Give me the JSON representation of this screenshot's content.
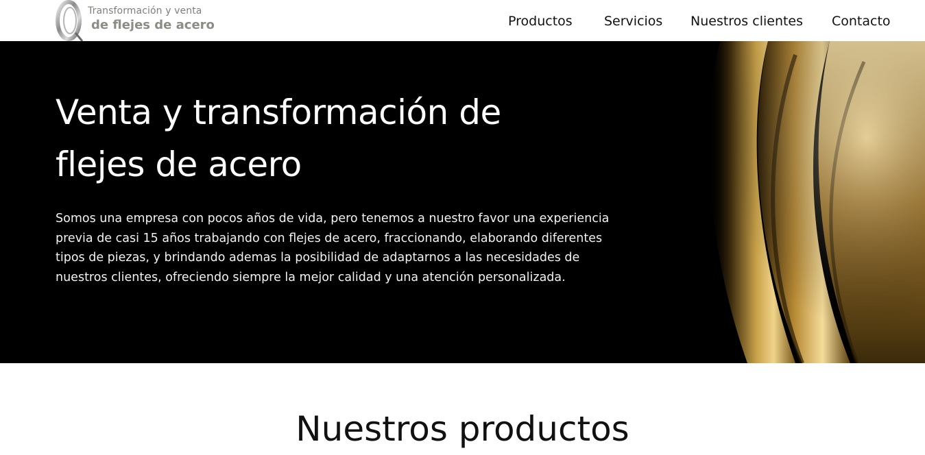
{
  "brand": {
    "tagline_top": "Transformación y venta",
    "tagline_bottom": "de flejes de acero",
    "logo_icon": "steel-coil-logo"
  },
  "nav": {
    "items": [
      {
        "label": "Productos"
      },
      {
        "label": "Servicios"
      },
      {
        "label": "Nuestros clientes"
      },
      {
        "label": "Contacto"
      }
    ]
  },
  "hero": {
    "title": "Venta y transformación de flejes de acero",
    "body": "Somos una empresa con pocos años de vida, pero tenemos a nuestro favor una experiencia previa de casi 15 años trabajando con flejes de acero, fraccionando, elaborando diferentes tipos de piezas, y brindando ademas la posibilidad de adaptarnos a las necesidades de nuestros clientes, ofreciendo siempre la mejor calidad y una atención personalizada.",
    "image": "golden-steel-coils-photo",
    "background_color": "#000000",
    "accent_color": "#c9a24a"
  },
  "products": {
    "title": "Nuestros productos"
  }
}
